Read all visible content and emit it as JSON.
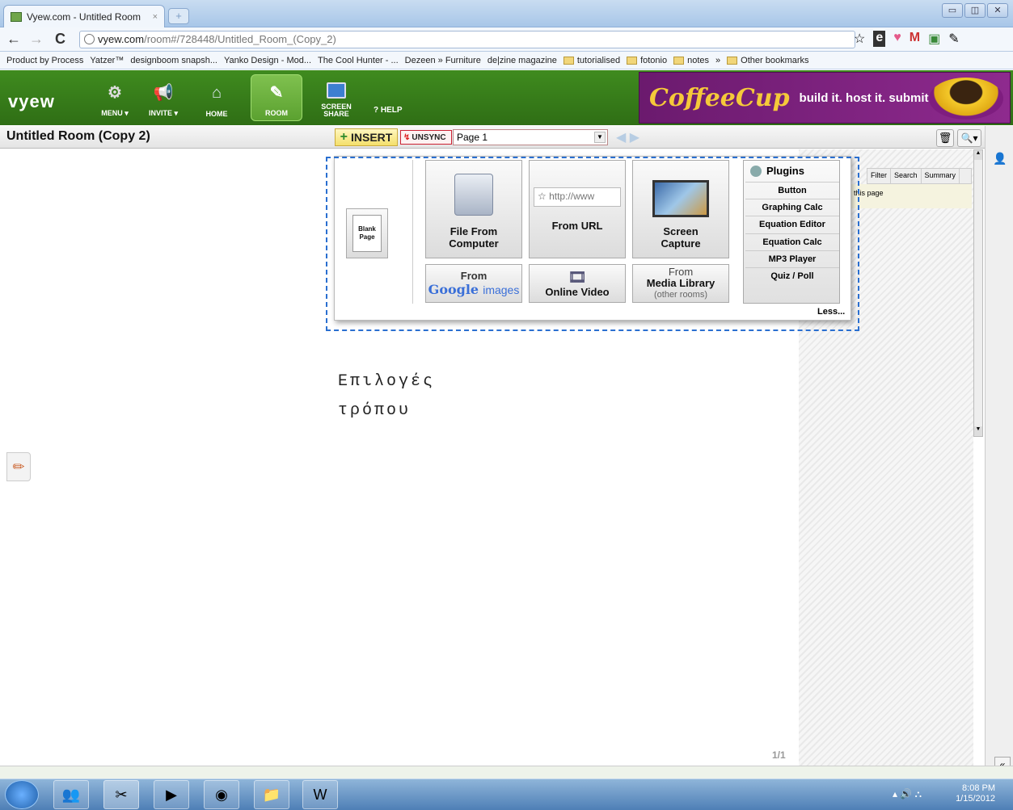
{
  "browser": {
    "tab_title": "Vyew.com - Untitled Room",
    "tab_close": "×",
    "new_tab": "+",
    "window_buttons": [
      "▭",
      "◫",
      "✕"
    ],
    "url_host": "vyew.com",
    "url_path": "/room#/728448/Untitled_Room_(Copy_2)",
    "nav": {
      "back": "←",
      "forward": "→",
      "reload": "C"
    },
    "toolbar_icons": [
      "☆",
      "e",
      "♥",
      "M",
      "▣",
      "✎"
    ],
    "bookmarks": [
      "Product by Process",
      "Yatzer™",
      "designboom snapsh...",
      "Yanko Design - Mod...",
      "The Cool Hunter - ...",
      "Dezeen » Furniture",
      "de|zine magazine",
      "tutorialised",
      "fotonio",
      "notes",
      "»",
      "Other bookmarks"
    ]
  },
  "app": {
    "logo": "vyew",
    "menu_label": "MENU ▾",
    "invite_label": "INVITE ▾",
    "home_label": "HOME",
    "room_label": "ROOM",
    "screen_share_label": "SCREEN SHARE",
    "help_label": "? HELP",
    "ad_brand": "CoffeeCup",
    "ad_tagline": "build it. host it. submit it."
  },
  "room": {
    "title": "Untitled Room (Copy 2)",
    "insert_label": "INSERT",
    "unsync_label": "UNSYNC",
    "page_select": "Page 1",
    "page_counter": "1/1"
  },
  "insert_menu": {
    "blank_page": [
      "Blank",
      "Page"
    ],
    "file_from_computer": [
      "File From",
      "Computer"
    ],
    "url_placeholder": "http://www",
    "from_url": "From URL",
    "screen_capture": [
      "Screen",
      "Capture"
    ],
    "from_google": "From",
    "google_brand": "Google",
    "google_images": "images",
    "online_video": "Online Video",
    "media_library": [
      "From",
      "Media Library",
      "(other rooms)"
    ],
    "plugins_title": "Plugins",
    "plugins": [
      "Button",
      "Graphing Calc",
      "Equation Editor",
      "Equation Calc",
      "MP3 Player",
      "Quiz / Poll"
    ],
    "less": "Less..."
  },
  "panel": {
    "tabs": [
      "Filter",
      "Search",
      "Summary"
    ],
    "note": "this page"
  },
  "annotation": {
    "line1": "Επιλογές",
    "line2": "τρόπου"
  },
  "taskbar": {
    "time": "8:08 PM",
    "date": "1/15/2012"
  }
}
